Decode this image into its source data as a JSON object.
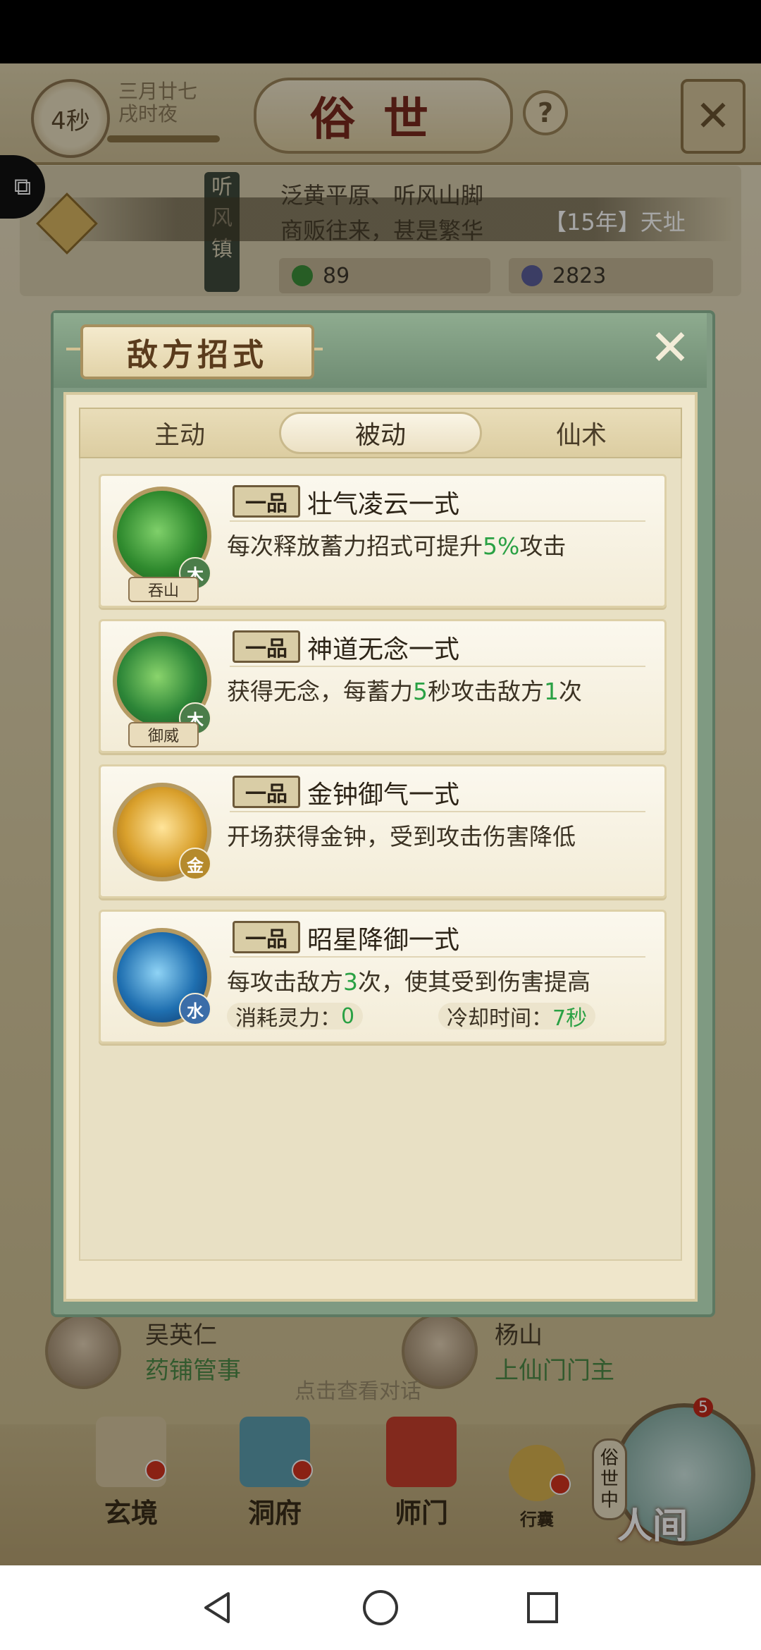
{
  "timer": "4秒",
  "game_date": {
    "line1": "三月廿七",
    "line2": "戌时夜"
  },
  "scene_title": "俗世",
  "help_symbol": "?",
  "location": {
    "name": "听风镇",
    "description_line1": "泛黄平原、听风山脚",
    "description_line2": "商贩往来，甚是繁华",
    "resource1_value": "89",
    "resource2_value": "2823"
  },
  "marquee_text": "【15年】天址",
  "background_npcs": [
    {
      "name": "吴英仁",
      "role": "药铺管事"
    },
    {
      "name": "杨山",
      "role": "上仙门门主"
    }
  ],
  "background_hint": "点击查看对话",
  "bottom_nav": [
    {
      "label": "玄境"
    },
    {
      "label": "洞府"
    },
    {
      "label": "师门"
    },
    {
      "label": "行囊"
    }
  ],
  "world_button": {
    "side_label": "俗世中",
    "label": "人间",
    "badge": "5"
  },
  "modal": {
    "title": "敌方招式",
    "tabs": [
      "主动",
      "被动",
      "仙术"
    ],
    "active_tab": "被动",
    "skills": [
      {
        "grade": "一品",
        "name": "壮气凌云一式",
        "icon_label": "吞山",
        "element": "木",
        "desc_parts": [
          "每次释放蓄力招式可提升",
          "5%",
          "攻击"
        ],
        "colors": {
          "icon": "#2f8a2e",
          "badge": "#4b7d4a"
        }
      },
      {
        "grade": "一品",
        "name": "神道无念一式",
        "icon_label": "御威",
        "element": "木",
        "desc_parts": [
          "获得无念，每蓄力",
          "5",
          "秒攻击敌方",
          "1",
          "次"
        ],
        "colors": {
          "icon": "#2c8537",
          "badge": "#4b7d4a"
        }
      },
      {
        "grade": "一品",
        "name": "金钟御气一式",
        "icon_label": "",
        "element": "金",
        "desc_parts": [
          "开场获得金钟，受到攻击伤害降低"
        ],
        "colors": {
          "icon": "#d9a02c",
          "badge": "#b58a2c"
        }
      },
      {
        "grade": "一品",
        "name": "昭星降御一式",
        "icon_label": "",
        "element": "水",
        "desc_parts": [
          "每攻击敌方",
          "3",
          "次，使其受到伤害提高"
        ],
        "cost_label": "消耗灵力：",
        "cost_value": "0",
        "cooldown_label": "冷却时间：",
        "cooldown_value": "7秒",
        "colors": {
          "icon": "#1f6fb0",
          "badge": "#3b6da8"
        }
      }
    ]
  },
  "colors": {
    "highlight_green": "#2aa144",
    "panel_green": "#7f9a82",
    "parchment": "#efe6cb"
  }
}
